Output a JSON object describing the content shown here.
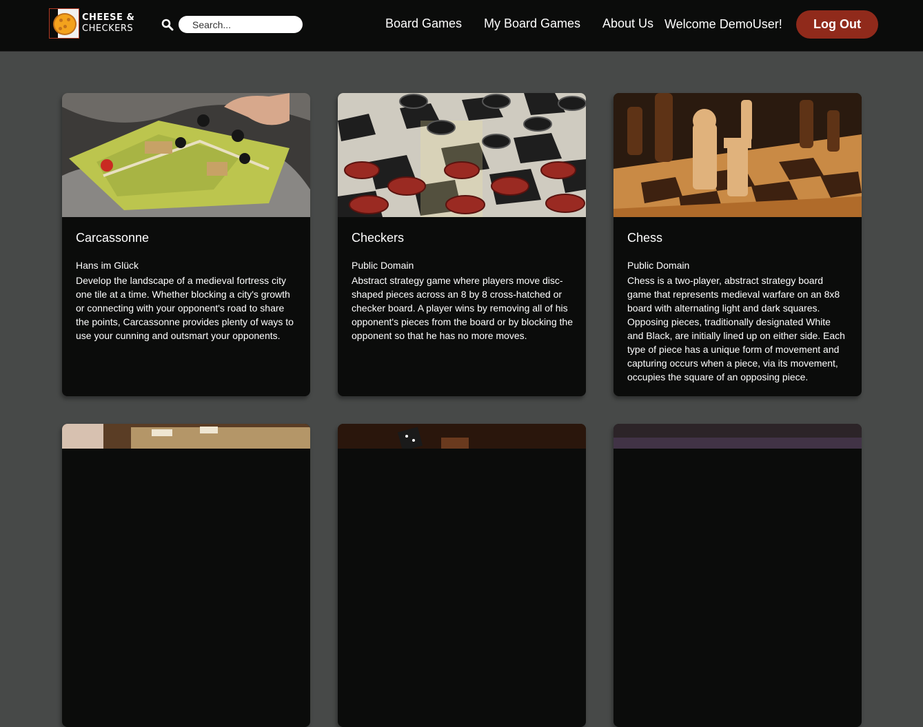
{
  "brand": {
    "line1": "CHEESE &",
    "line2": "CHECKERS"
  },
  "search": {
    "placeholder": "Search..."
  },
  "nav": {
    "links": [
      "Board Games",
      "My Board Games",
      "About Us"
    ],
    "welcome": "Welcome DemoUser!",
    "logout_label": "Log Out"
  },
  "colors": {
    "navbar": "#0b0c0b",
    "page_bg": "#474948",
    "card_bg": "#0b0c0b",
    "logout": "#902a1b"
  },
  "games": [
    {
      "title": "Carcassonne",
      "publisher": "Hans im Glück",
      "description": "Develop the landscape of a medieval fortress city one tile at a time. Whether blocking a city's growth or connecting with your opponent's road to share the points, Carcassonne provides plenty of ways to use your cunning and outsmart your opponents."
    },
    {
      "title": "Checkers",
      "publisher": "Public Domain",
      "description": "Abstract strategy game where players move disc-shaped pieces across an 8 by 8 cross-hatched or checker board. A player wins by removing all of his opponent's pieces from the board or by blocking the opponent so that he has no more moves."
    },
    {
      "title": "Chess",
      "publisher": "Public Domain",
      "description": "Chess is a two-player, abstract strategy board game that represents medieval warfare on an 8x8 board with alternating light and dark squares. Opposing pieces, traditionally designated White and Black, are initially lined up on either side. Each type of piece has a unique form of movement and capturing occurs when a piece, via its movement, occupies the square of an opposing piece."
    }
  ]
}
